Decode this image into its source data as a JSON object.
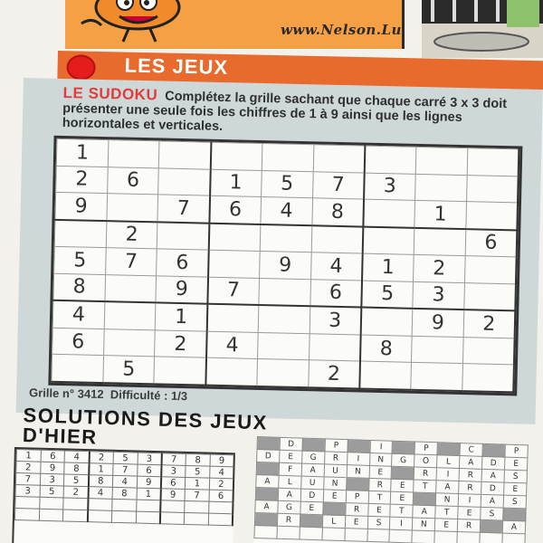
{
  "header": {
    "url": "www.Nelson.Lu",
    "section_title": "LES JEUX"
  },
  "sudoku": {
    "lead": "LE SUDOKU",
    "instructions": "Complétez la grille sachant que chaque carré 3 x 3 doit présenter une seule fois les chiffres de 1 à 9 ainsi que les lignes horizontales et verticales.",
    "grid": [
      [
        "1",
        "",
        "",
        "",
        "",
        "",
        "",
        "",
        ""
      ],
      [
        "2",
        "6",
        "",
        "1",
        "5",
        "7",
        "3",
        "",
        ""
      ],
      [
        "9",
        "",
        "7",
        "6",
        "4",
        "8",
        "",
        "1",
        ""
      ],
      [
        "",
        "2",
        "",
        "",
        "",
        "",
        "",
        "",
        "6"
      ],
      [
        "5",
        "7",
        "6",
        "",
        "9",
        "4",
        "1",
        "2",
        ""
      ],
      [
        "8",
        "",
        "9",
        "7",
        "",
        "6",
        "5",
        "3",
        ""
      ],
      [
        "4",
        "",
        "1",
        "",
        "",
        "3",
        "",
        "9",
        "2"
      ],
      [
        "6",
        "",
        "2",
        "4",
        "",
        "",
        "8",
        "",
        ""
      ],
      [
        "",
        "5",
        "",
        "",
        "",
        "2",
        "",
        "",
        ""
      ]
    ],
    "grille_label": "Grille n° 3412",
    "difficulte_label": "Difficulté : 1/3"
  },
  "solutions": {
    "title_line1": "SOLUTIONS DES JEUX",
    "title_line2": "D'HIER",
    "sudoku_rows": [
      [
        "1",
        "6",
        "4",
        "2",
        "5",
        "3",
        "7",
        "8",
        "9"
      ],
      [
        "2",
        "9",
        "8",
        "1",
        "7",
        "6",
        "3",
        "5",
        "4"
      ],
      [
        "7",
        "3",
        "5",
        "8",
        "4",
        "9",
        "6",
        "1",
        "2"
      ],
      [
        "3",
        "5",
        "2",
        "4",
        "8",
        "1",
        "9",
        "7",
        "6"
      ],
      [
        "",
        "",
        "",
        "",
        "",
        "",
        "",
        "",
        ""
      ],
      [
        "",
        "",
        "",
        "",
        "",
        "",
        "",
        "",
        ""
      ]
    ],
    "words_rows": [
      [
        "#",
        "D",
        "#",
        "P",
        "#",
        "I",
        "#",
        "P",
        "#",
        "C",
        "#",
        "P"
      ],
      [
        "D",
        "E",
        "G",
        "R",
        "I",
        "N",
        "G",
        "O",
        "L",
        "A",
        "D",
        "E"
      ],
      [
        "#",
        "F",
        "A",
        "U",
        "N",
        "E",
        "#",
        "R",
        "I",
        "R",
        "A",
        "S"
      ],
      [
        "A",
        "L",
        "U",
        "N",
        "#",
        "R",
        "E",
        "T",
        "A",
        "R",
        "D",
        "E"
      ],
      [
        "#",
        "A",
        "D",
        "E",
        "P",
        "T",
        "E",
        "#",
        "N",
        "I",
        "A",
        "S"
      ],
      [
        "A",
        "G",
        "E",
        "#",
        "R",
        "E",
        "T",
        "A",
        "T",
        "E",
        "S",
        "#"
      ],
      [
        "#",
        "R",
        "#",
        "L",
        "E",
        "S",
        "I",
        "N",
        "E",
        "R",
        "#",
        "A"
      ],
      [
        "",
        "",
        "",
        "",
        "",
        "",
        "",
        "",
        "",
        "",
        "",
        ""
      ]
    ]
  }
}
